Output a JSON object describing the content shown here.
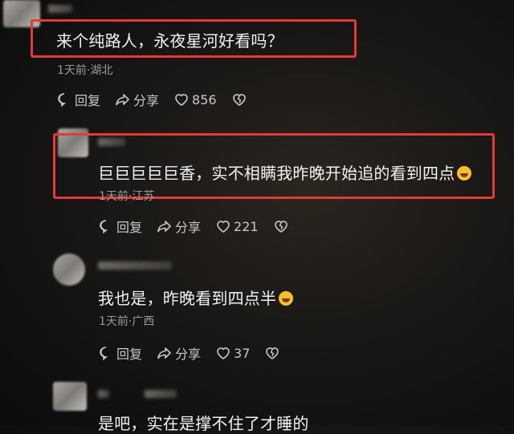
{
  "comments": [
    {
      "text": "来个纯路人，永夜星河好看吗？",
      "time_location": "1天前·湖北",
      "reply_label": "回复",
      "share_label": "分享",
      "likes": "856"
    },
    {
      "text": "巨巨巨巨巨香，实不相瞒我昨晚开始追的看到四点",
      "emoji": "laughing-tears-emoji",
      "time_location": "1天前·江苏",
      "reply_label": "回复",
      "share_label": "分享",
      "likes": "221"
    },
    {
      "text": "我也是，昨晚看到四点半",
      "emoji": "laughing-tears-emoji",
      "time_location": "1天前·广西",
      "reply_label": "回复",
      "share_label": "分享",
      "likes": "37"
    },
    {
      "text": "是吧，实在是撑不住了才睡的"
    }
  ],
  "highlight_color": "#e53935"
}
